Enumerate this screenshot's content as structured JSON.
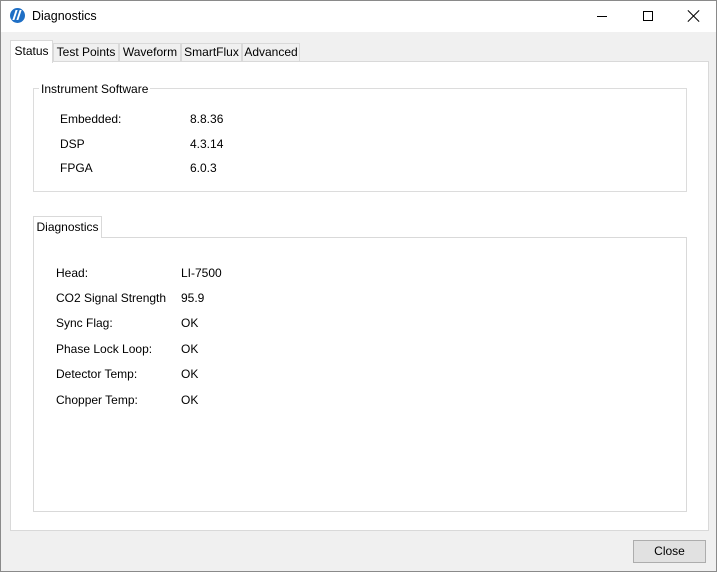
{
  "window": {
    "title": "Diagnostics",
    "controls": [
      "minimize",
      "maximize",
      "close"
    ]
  },
  "tabs": [
    {
      "label": "Status",
      "active": true
    },
    {
      "label": "Test Points",
      "active": false
    },
    {
      "label": "Waveform",
      "active": false
    },
    {
      "label": "SmartFlux",
      "active": false
    },
    {
      "label": "Advanced",
      "active": false
    }
  ],
  "instrument_software": {
    "title": "Instrument Software",
    "rows": [
      {
        "label": "Embedded:",
        "value": "8.8.36"
      },
      {
        "label": "DSP",
        "value": "4.3.14"
      },
      {
        "label": "FPGA",
        "value": "6.0.3"
      }
    ]
  },
  "diagnostics": {
    "tab_label": "Diagnostics",
    "rows": [
      {
        "label": "Head:",
        "value": "LI-7500"
      },
      {
        "label": "CO2 Signal Strength",
        "value": "95.9"
      },
      {
        "label": "Sync Flag:",
        "value": "OK"
      },
      {
        "label": "Phase Lock Loop:",
        "value": "OK"
      },
      {
        "label": "Detector Temp:",
        "value": "OK"
      },
      {
        "label": "Chopper Temp:",
        "value": "OK"
      }
    ]
  },
  "footer": {
    "close_label": "Close"
  },
  "icons": {
    "app": "app-logo-icon",
    "minimize": "minimize-icon",
    "maximize": "maximize-icon",
    "close": "close-icon"
  },
  "colors": {
    "window_background": "#f0f0f0",
    "panel_background": "#ffffff",
    "border": "#d9d9d9",
    "button_face": "#e1e1e1",
    "app_icon": "#1f6fc5"
  }
}
